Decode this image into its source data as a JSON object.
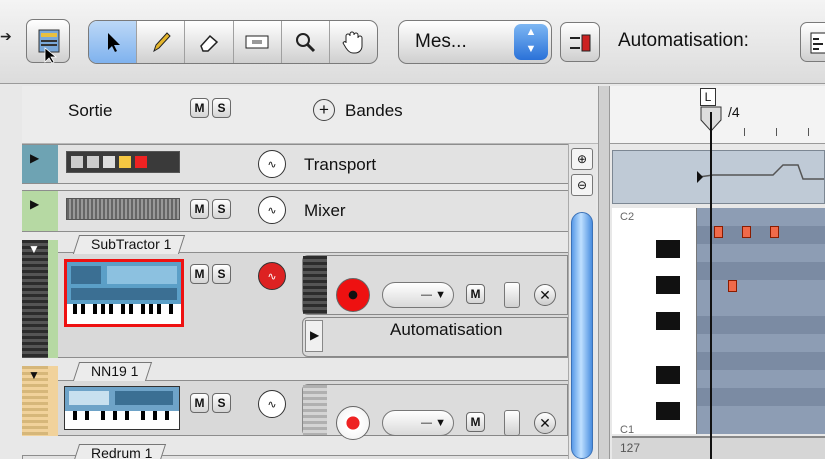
{
  "toolbar": {
    "mode_select": "Mes...",
    "automation_label": "Automatisation:"
  },
  "header": {
    "output_label": "Sortie",
    "mute": "M",
    "solo": "S",
    "add_symbol": "+",
    "lanes_label": "Bandes"
  },
  "tracks": [
    {
      "name": "Transport",
      "color": "#6ea3b3"
    },
    {
      "name": "Mixer",
      "color": "#b6d9a3"
    },
    {
      "name": "SubTractor 1",
      "color": "#b6d9a3",
      "lane_label": "Automatisation"
    },
    {
      "name": "NN19 1",
      "color": "#f1d29b"
    },
    {
      "name": "Redrum 1"
    }
  ],
  "buttons": {
    "mute": "M",
    "solo": "S",
    "remove": "✕"
  },
  "ruler": {
    "marker": "L",
    "signature": "/4"
  },
  "piano_roll": {
    "note_label_top": "C2",
    "note_label_bottom": "C1"
  },
  "velocity": {
    "value": "127"
  }
}
